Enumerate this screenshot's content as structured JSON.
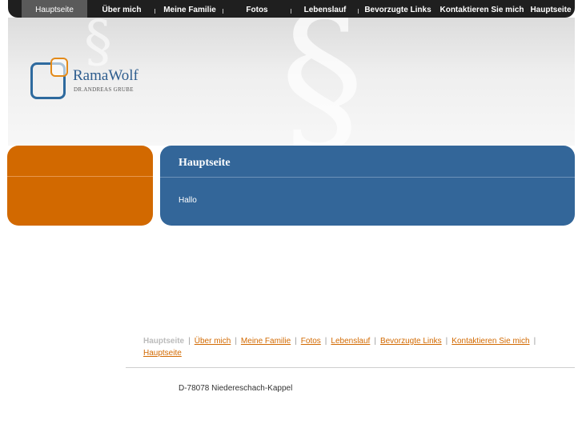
{
  "top_nav": {
    "items": [
      {
        "label": "Hauptseite",
        "active": true
      },
      {
        "label": "Über mich"
      },
      {
        "label": "Meine Familie"
      },
      {
        "label": "Fotos"
      },
      {
        "label": "Lebenslauf"
      },
      {
        "label": "Bevorzugte Links"
      },
      {
        "label": "Kontaktieren Sie mich"
      },
      {
        "label": "Hauptseite"
      }
    ],
    "plus_symbol": "+"
  },
  "header": {
    "watermark_symbol": "§"
  },
  "logo": {
    "name": "RamaWolf",
    "subtitle": "DR.ANDREAS GRUBE"
  },
  "content": {
    "title": "Hauptseite",
    "body": "Hallo"
  },
  "footer_nav": {
    "items": [
      "Hauptseite",
      "Über mich",
      "Meine Familie",
      "Fotos",
      "Lebenslauf",
      "Bevorzugte Links",
      "Kontaktieren Sie mich",
      "Hauptseite"
    ],
    "separator": "|"
  },
  "footer": {
    "address": "D-78078 Niedereschach-Kappel"
  },
  "colors": {
    "accent_orange": "#d26900",
    "accent_blue": "#336699",
    "nav_dark": "#1f1f1f"
  }
}
